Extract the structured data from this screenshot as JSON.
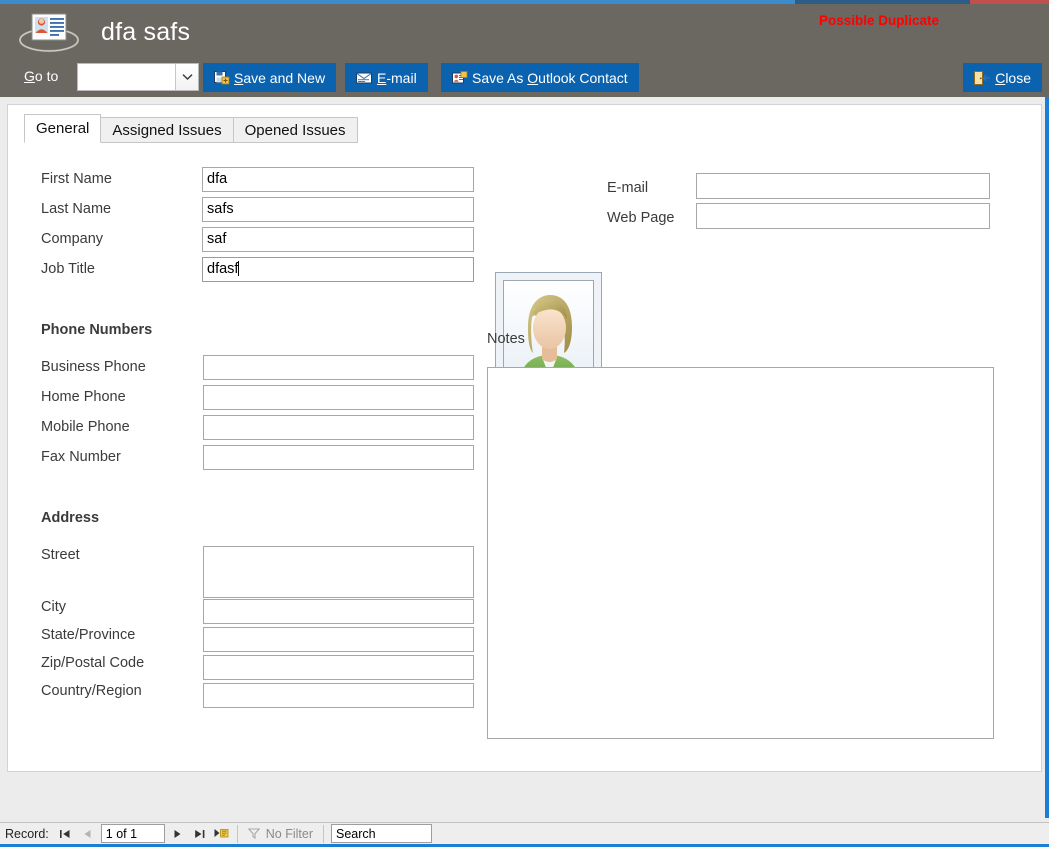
{
  "window": {
    "accent_blue": "#1a7fd4",
    "header_bg": "#6b6862",
    "button_blue": "#0b63b0"
  },
  "header": {
    "app_icon": "contact-card-icon",
    "title": "dfa safs",
    "duplicate_warning": "Possible Duplicate",
    "duplicate_color": "#ff0000",
    "goto_label_pre": "G",
    "goto_label_post": "o to",
    "goto_value": "",
    "buttons": {
      "save_and_new": "Save and New",
      "save_and_new_accel": "S",
      "save_and_new_rest": "ave and New",
      "email_accel": "E",
      "email_rest": "-mail",
      "outlook_pre": "Save As ",
      "outlook_accel": "O",
      "outlook_rest": "utlook Contact",
      "close_accel": "C",
      "close_rest": "lose"
    }
  },
  "tabs": [
    {
      "label": "General",
      "active": true
    },
    {
      "label": "Assigned Issues",
      "active": false
    },
    {
      "label": "Opened Issues",
      "active": false
    }
  ],
  "form": {
    "identity": [
      {
        "label": "First Name",
        "value": "dfa",
        "focused": false
      },
      {
        "label": "Last Name",
        "value": "safs",
        "focused": false
      },
      {
        "label": "Company",
        "value": "saf",
        "focused": false
      },
      {
        "label": "Job Title",
        "value": "dfasf",
        "focused": true
      }
    ],
    "phone_section_header": "Phone Numbers",
    "phones": [
      {
        "label": "Business Phone",
        "value": ""
      },
      {
        "label": "Home Phone",
        "value": ""
      },
      {
        "label": "Mobile Phone",
        "value": ""
      },
      {
        "label": "Fax Number",
        "value": ""
      }
    ],
    "address_section_header": "Address",
    "address": [
      {
        "label": "Street",
        "value": "",
        "tall": true
      },
      {
        "label": "City",
        "value": "",
        "tall": false
      },
      {
        "label": "State/Province",
        "value": "",
        "tall": false
      },
      {
        "label": "Zip/Postal Code",
        "value": "",
        "tall": false
      },
      {
        "label": "Country/Region",
        "value": "",
        "tall": false
      }
    ],
    "contact": [
      {
        "label": "E-mail",
        "value": ""
      },
      {
        "label": "Web Page",
        "value": ""
      }
    ],
    "photo_alt": "contact-photo-placeholder",
    "notes_label": "Notes",
    "notes_value": ""
  },
  "record_nav": {
    "record_label": "Record:",
    "first_icon": "go-to-first-record-icon",
    "prev_icon": "go-to-previous-record-icon",
    "position_text": "1 of 1",
    "next_icon": "go-to-next-record-icon",
    "last_icon": "go-to-last-record-icon",
    "new_icon": "new-blank-record-icon",
    "filter_icon": "filter-funnel-icon",
    "filter_label": "No Filter",
    "search_placeholder": "Search",
    "search_value": "Search"
  }
}
